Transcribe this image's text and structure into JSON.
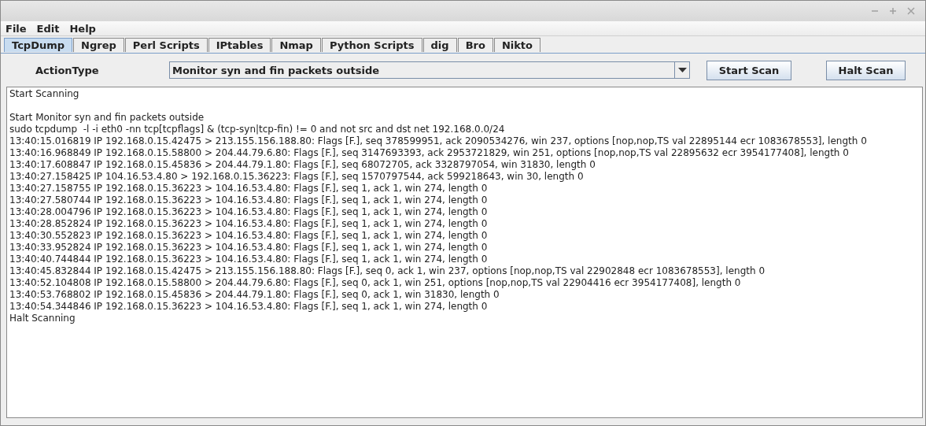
{
  "menu": [
    "File",
    "Edit",
    "Help"
  ],
  "tabs": [
    {
      "label": "TcpDump",
      "selected": true
    },
    {
      "label": "Ngrep",
      "selected": false
    },
    {
      "label": "Perl Scripts",
      "selected": false
    },
    {
      "label": "IPtables",
      "selected": false
    },
    {
      "label": "Nmap",
      "selected": false
    },
    {
      "label": "Python Scripts",
      "selected": false
    },
    {
      "label": "dig",
      "selected": false
    },
    {
      "label": "Bro",
      "selected": false
    },
    {
      "label": "Nikto",
      "selected": false
    }
  ],
  "action_label": "ActionType",
  "action_select": {
    "value": "Monitor syn and fin packets outside"
  },
  "buttons": [
    "Start Scan",
    "Halt Scan"
  ],
  "output": {
    "sections": [
      [
        "Start Scanning"
      ],
      [
        "Start Monitor syn and fin packets outside",
        "sudo tcpdump  -l -i eth0 -nn tcp[tcpflags] & (tcp-syn|tcp-fin) != 0 and not src and dst net 192.168.0.0/24",
        "13:40:15.016819 IP 192.168.0.15.42475 > 213.155.156.188.80: Flags [F.], seq 378599951, ack 2090534276, win 237, options [nop,nop,TS val 22895144 ecr 1083678553], length 0",
        "13:40:16.968849 IP 192.168.0.15.58800 > 204.44.79.6.80: Flags [F.], seq 3147693393, ack 2953721829, win 251, options [nop,nop,TS val 22895632 ecr 3954177408], length 0",
        "13:40:17.608847 IP 192.168.0.15.45836 > 204.44.79.1.80: Flags [F.], seq 68072705, ack 3328797054, win 31830, length 0",
        "13:40:27.158425 IP 104.16.53.4.80 > 192.168.0.15.36223: Flags [F.], seq 1570797544, ack 599218643, win 30, length 0",
        "13:40:27.158755 IP 192.168.0.15.36223 > 104.16.53.4.80: Flags [F.], seq 1, ack 1, win 274, length 0",
        "13:40:27.580744 IP 192.168.0.15.36223 > 104.16.53.4.80: Flags [F.], seq 1, ack 1, win 274, length 0",
        "13:40:28.004796 IP 192.168.0.15.36223 > 104.16.53.4.80: Flags [F.], seq 1, ack 1, win 274, length 0",
        "13:40:28.852824 IP 192.168.0.15.36223 > 104.16.53.4.80: Flags [F.], seq 1, ack 1, win 274, length 0",
        "13:40:30.552823 IP 192.168.0.15.36223 > 104.16.53.4.80: Flags [F.], seq 1, ack 1, win 274, length 0",
        "13:40:33.952824 IP 192.168.0.15.36223 > 104.16.53.4.80: Flags [F.], seq 1, ack 1, win 274, length 0",
        "13:40:40.744844 IP 192.168.0.15.36223 > 104.16.53.4.80: Flags [F.], seq 1, ack 1, win 274, length 0",
        "13:40:45.832844 IP 192.168.0.15.42475 > 213.155.156.188.80: Flags [F.], seq 0, ack 1, win 237, options [nop,nop,TS val 22902848 ecr 1083678553], length 0",
        "13:40:52.104808 IP 192.168.0.15.58800 > 204.44.79.6.80: Flags [F.], seq 0, ack 1, win 251, options [nop,nop,TS val 22904416 ecr 3954177408], length 0",
        "13:40:53.768802 IP 192.168.0.15.45836 > 204.44.79.1.80: Flags [F.], seq 0, ack 1, win 31830, length 0",
        "13:40:54.344846 IP 192.168.0.15.36223 > 104.16.53.4.80: Flags [F.], seq 1, ack 1, win 274, length 0",
        "Halt Scanning"
      ]
    ]
  }
}
